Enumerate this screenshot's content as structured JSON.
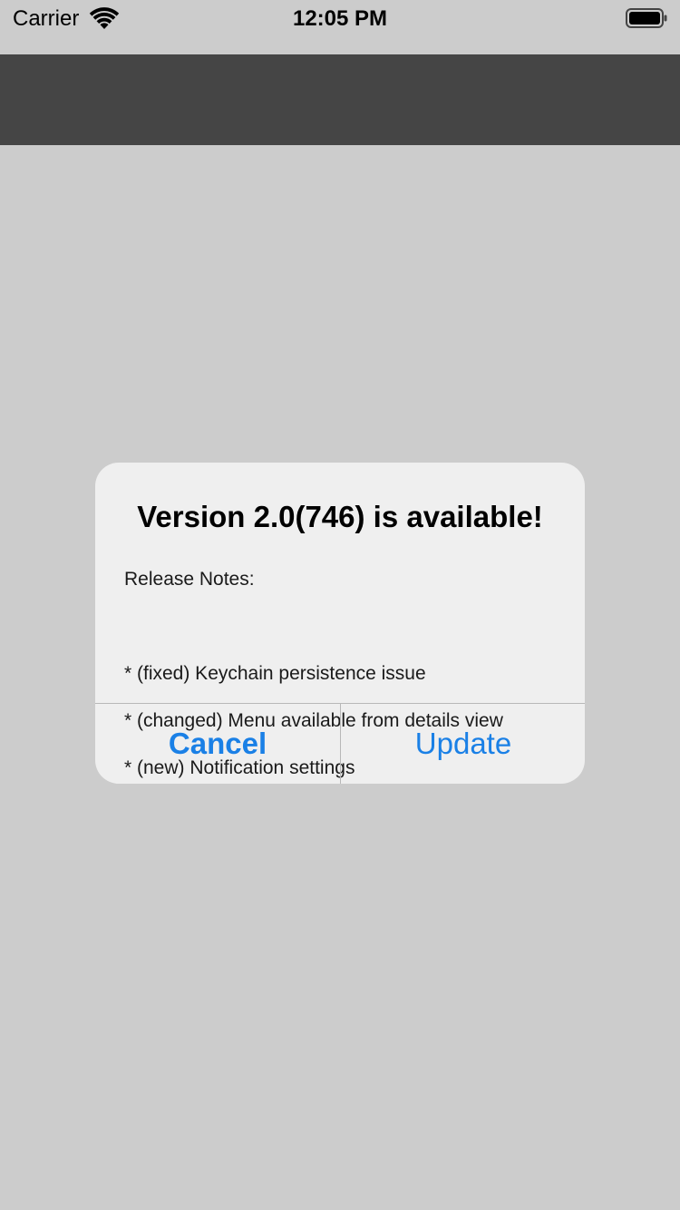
{
  "status_bar": {
    "carrier": "Carrier",
    "time": "12:05 PM",
    "wifi_icon": "wifi-icon",
    "battery_icon": "battery-icon"
  },
  "nav_bar": {
    "color": "#454545"
  },
  "alert": {
    "title": "Version 2.0(746) is available!",
    "message_heading": "Release Notes:",
    "message_lines": [
      "* (fixed) Keychain persistence issue",
      "* (changed) Menu available from details view",
      "* (new) Notification settings"
    ],
    "cancel_label": "Cancel",
    "update_label": "Update",
    "accent_color": "#1a80e6"
  }
}
